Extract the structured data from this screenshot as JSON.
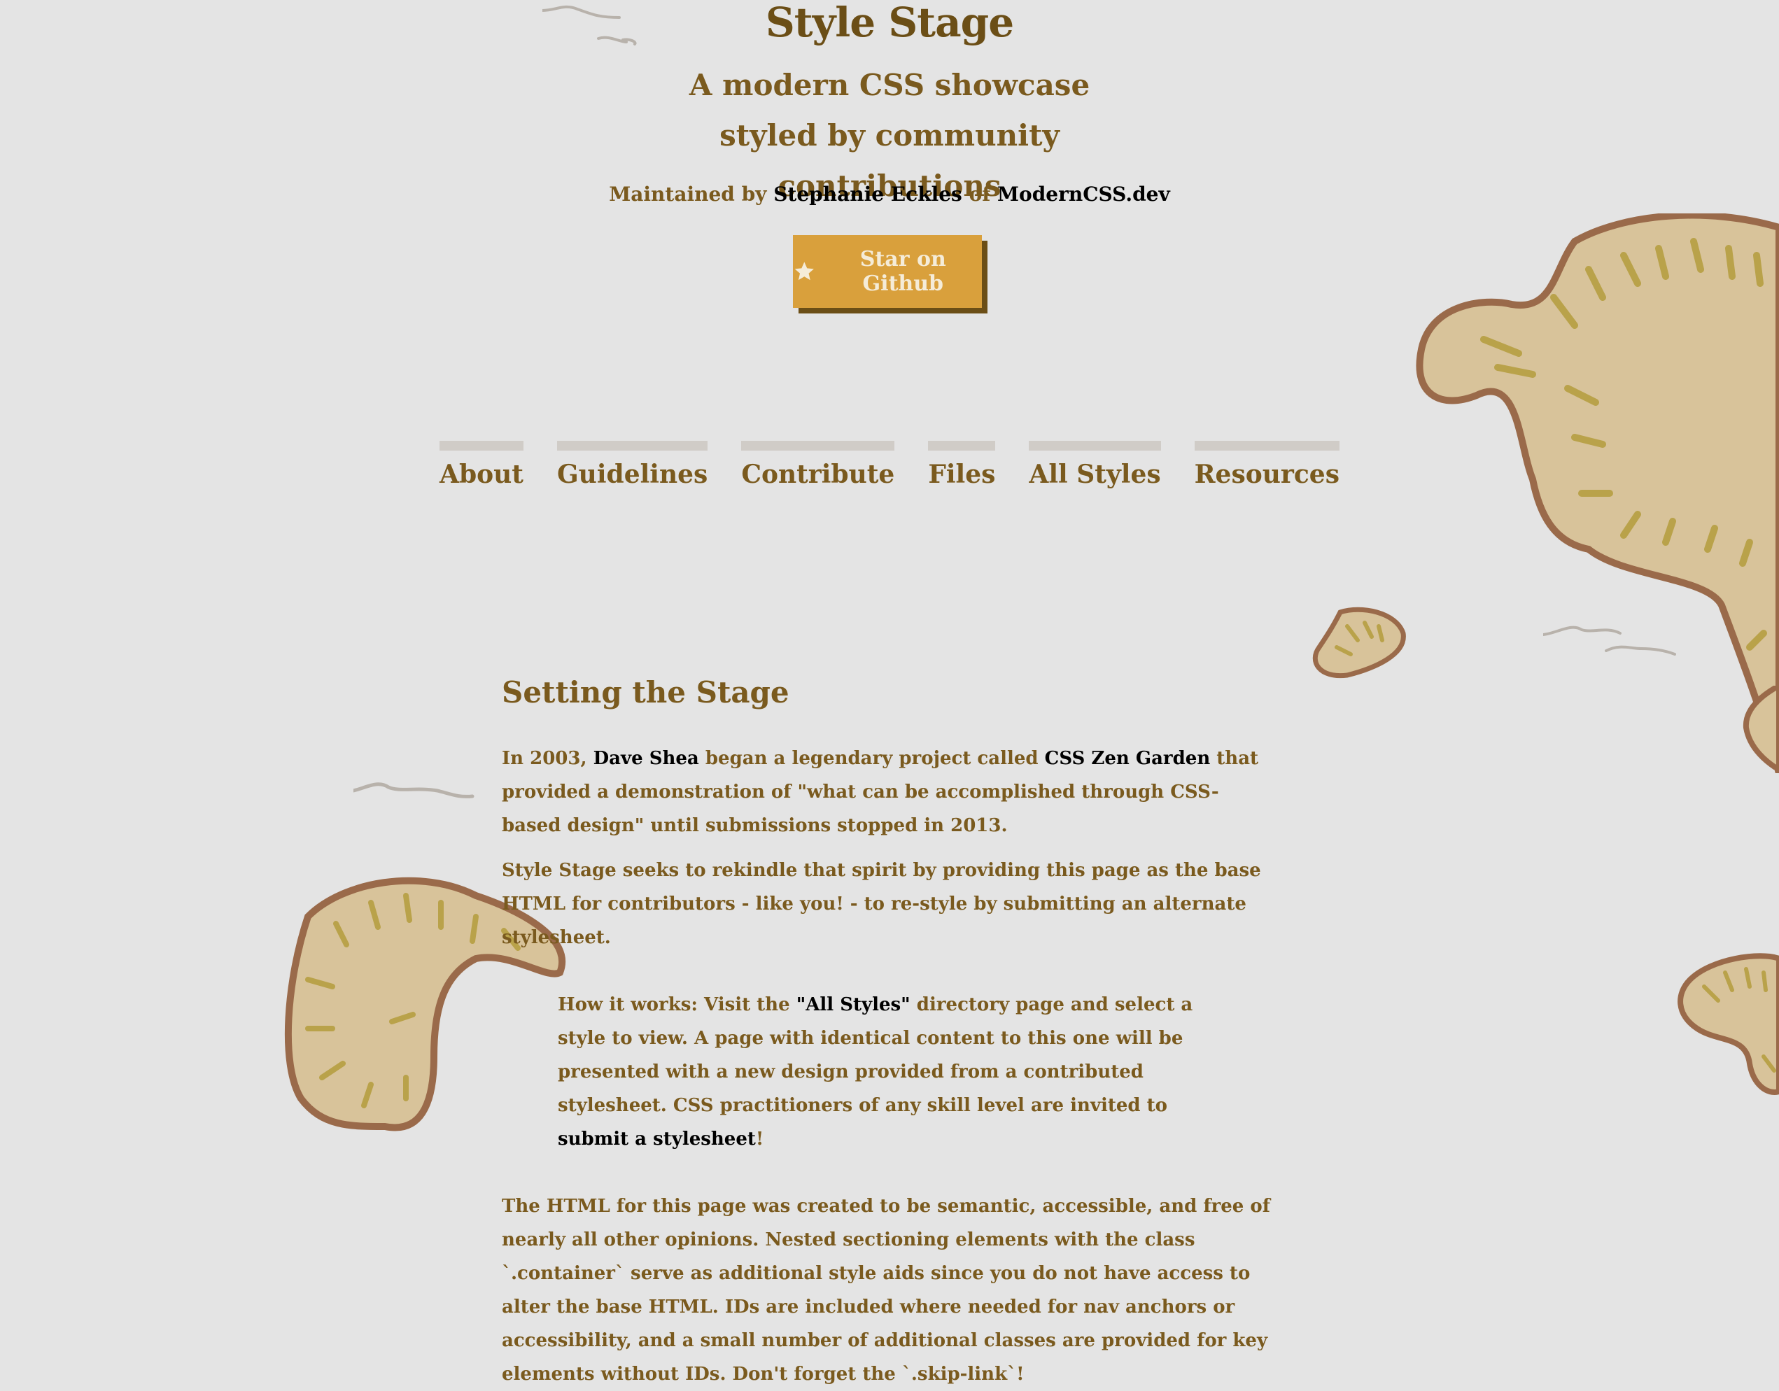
{
  "header": {
    "title": "Style Stage",
    "tagline": "A modern CSS showcase styled by community contributions",
    "maintained_prefix": "Maintained by",
    "maintainer_name": "Stephanie Eckles",
    "maintained_of": "of",
    "maintainer_site": "ModernCSS.dev",
    "github_button": "Star on Github"
  },
  "nav": {
    "items": [
      {
        "label": "About"
      },
      {
        "label": "Guidelines"
      },
      {
        "label": "Contribute"
      },
      {
        "label": "Files"
      },
      {
        "label": "All Styles"
      },
      {
        "label": "Resources"
      }
    ]
  },
  "main": {
    "section_title": "Setting the Stage",
    "p1": {
      "a": "In 2003,",
      "link1": "Dave Shea",
      "b": "began a legendary project called",
      "link2": "CSS Zen Garden",
      "c": "that provided a demonstration of \"what can be accomplished through CSS-based design\" until submissions stopped in 2013."
    },
    "p2": "Style Stage seeks to rekindle that spirit by providing this page as the base HTML for contributors - like you! - to re-style by submitting an alternate stylesheet.",
    "p3": {
      "a": "How it works: Visit the",
      "link1": "\"All Styles\"",
      "b": "directory page and select a style to view. A page with identical content to this one will be presented with a new design provided from a contributed stylesheet. CSS practitioners of any skill level are invited to",
      "link2": "submit a stylesheet",
      "c": "!"
    },
    "p4": "The HTML for this page was created to be semantic, accessible, and free of nearly all other opinions. Nested sectioning elements with the class `.container` serve as additional style aids since you do not have access to alter the base HTML. IDs are included where needed for nav anchors or accessibility, and a small number of additional classes are provided for key elements without IDs. Don't forget the `.skip-link`!"
  },
  "colors": {
    "background": "#e4e4e4",
    "text": "#7a5a1e",
    "title": "#6b4e16",
    "button": "#d9a03c",
    "button_shadow": "#6b4e16",
    "link": "#000000",
    "island_fill": "#d8c39a",
    "island_stroke": "#9a6a4a",
    "island_stripes": "#b9a24a"
  },
  "icons": {
    "github_button_icon": "star-icon"
  }
}
